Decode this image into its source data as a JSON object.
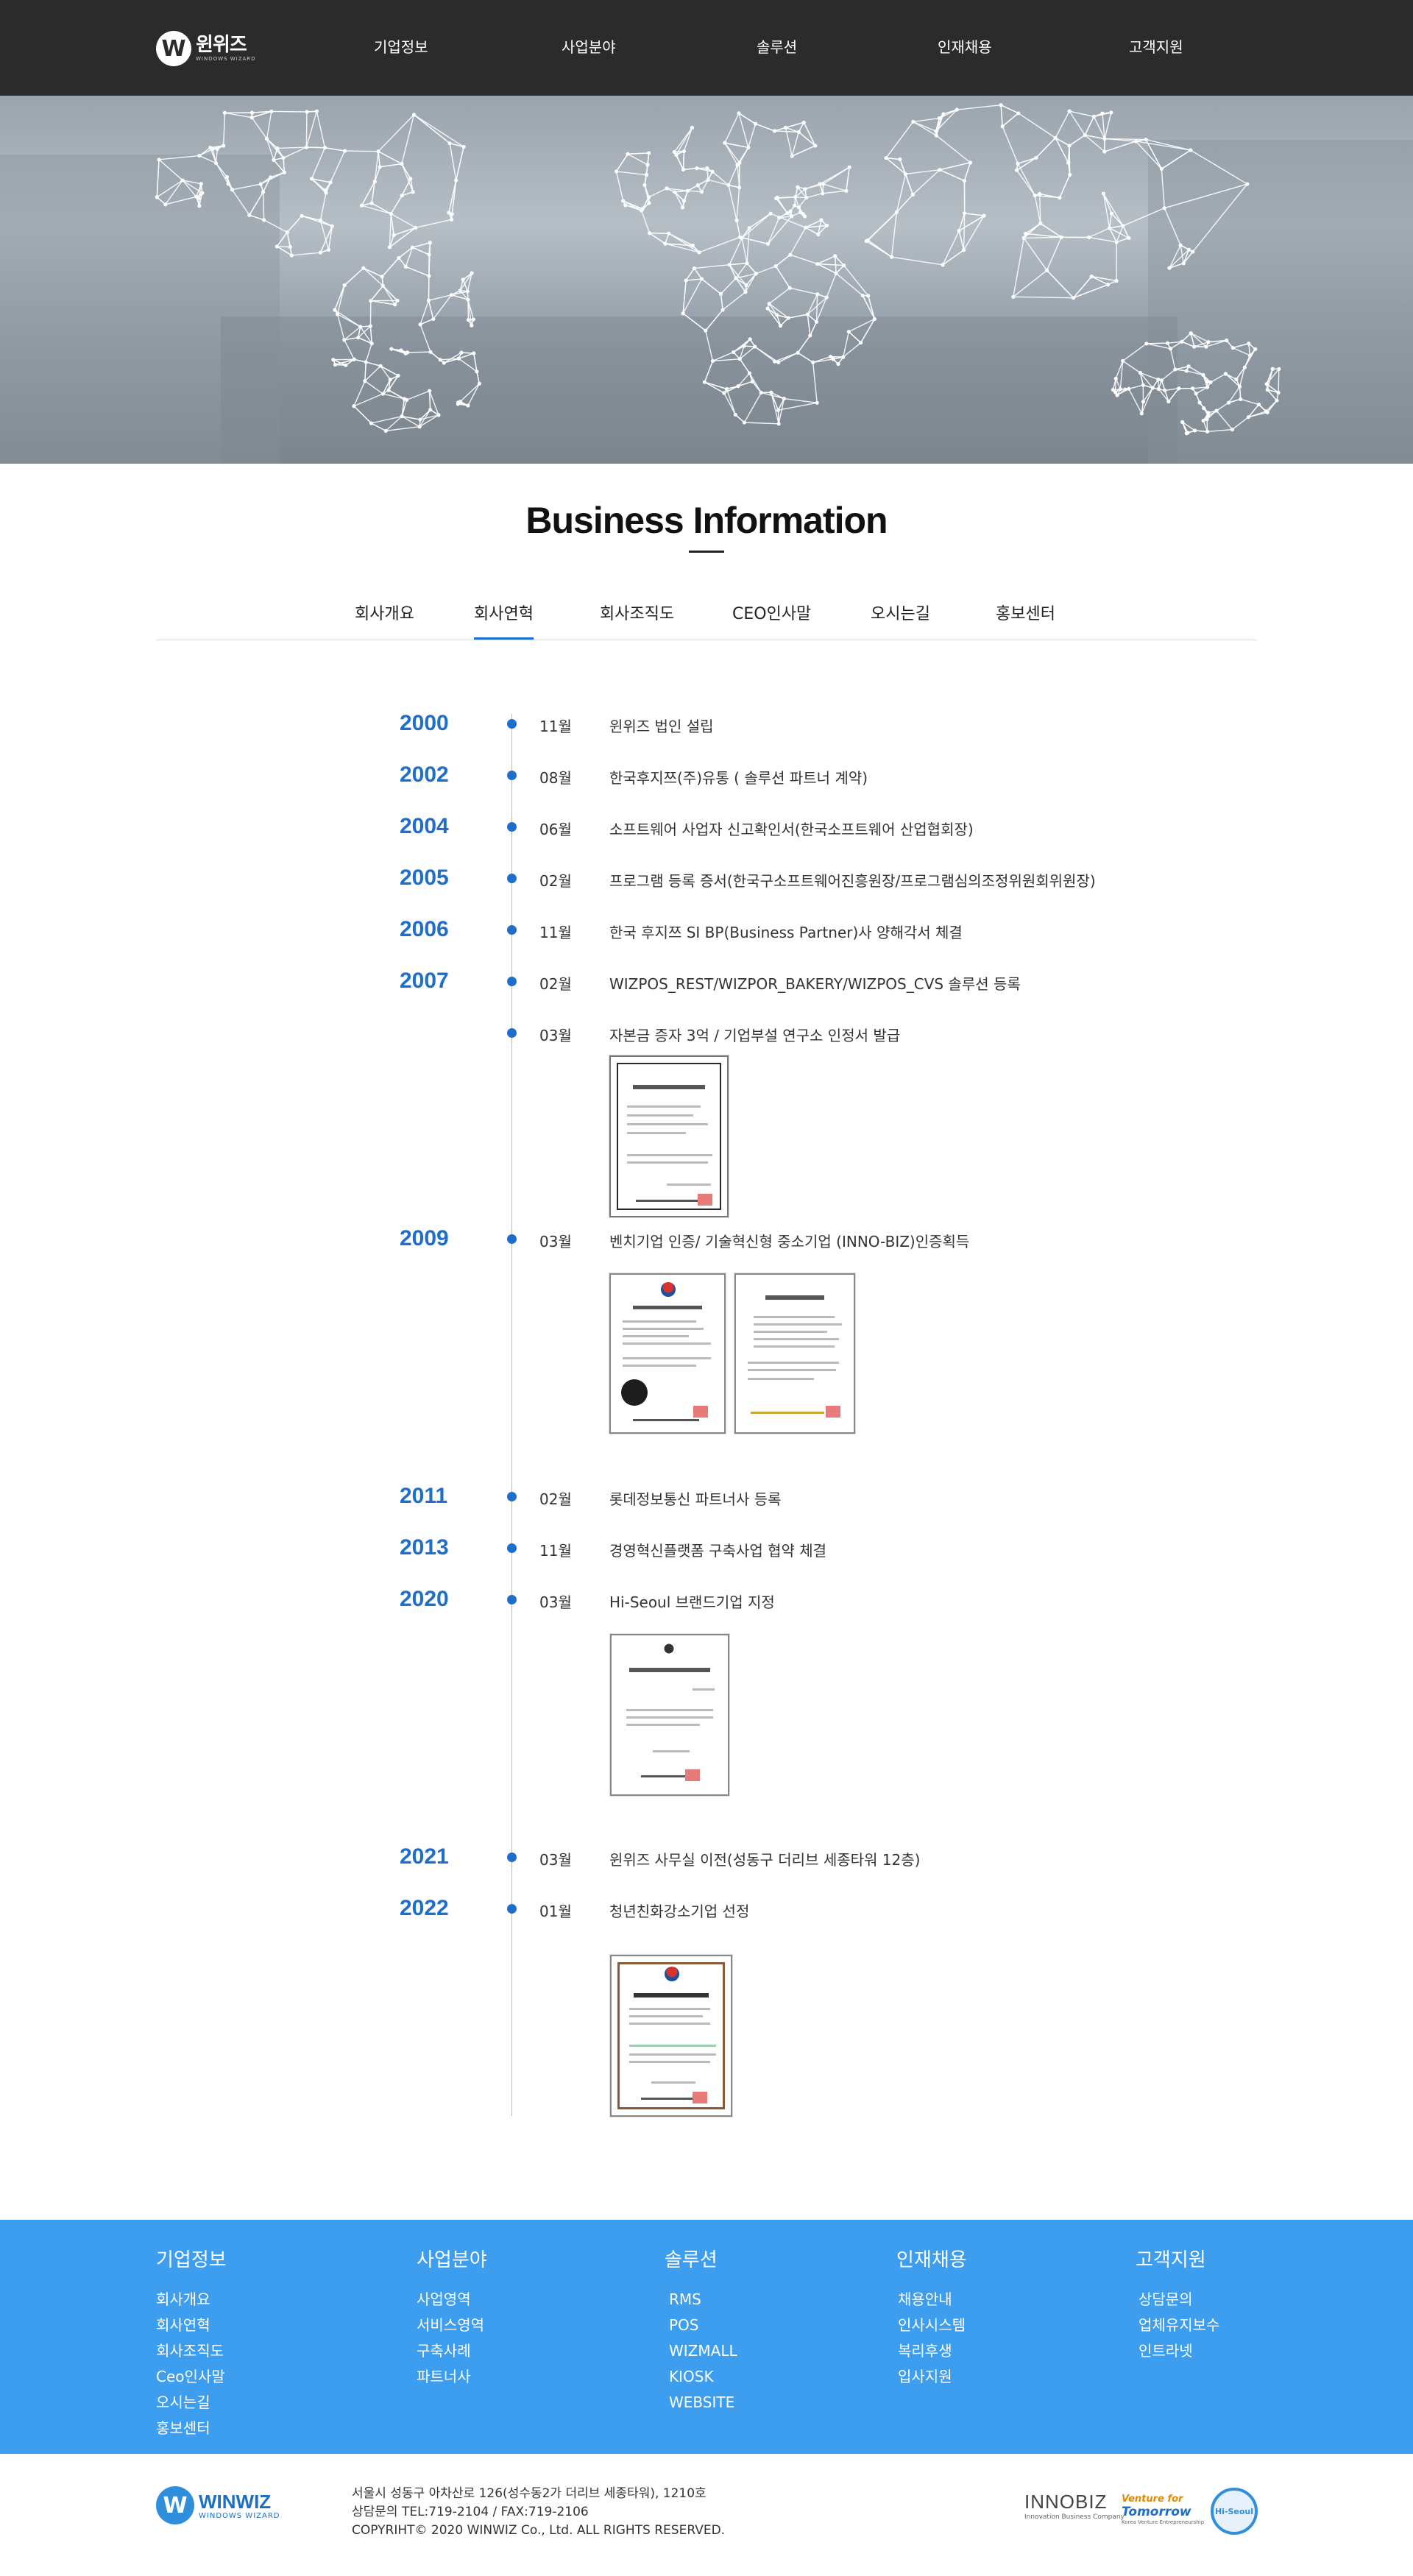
{
  "header": {
    "logo_letter": "W",
    "logo_text": "윈위즈",
    "logo_sub": "WINDOWS WIZARD",
    "nav": [
      "기업정보",
      "사업분야",
      "솔루션",
      "인재채용",
      "고객지원"
    ]
  },
  "main": {
    "title": "Business Information",
    "tabs": [
      "회사개요",
      "회사연혁",
      "회사조직도",
      "CEO인사말",
      "오시는길",
      "홍보센터"
    ],
    "active_tab": "회사연혁"
  },
  "history": [
    {
      "year": "2000",
      "month": "11월",
      "text": "윈위즈 법인 설립"
    },
    {
      "year": "2002",
      "month": "08월",
      "text": "한국후지쯔(주)유통 ( 솔루션 파트너 계약)"
    },
    {
      "year": "2004",
      "month": "06월",
      "text": "소프트웨어 사업자 신고확인서(한국소프트웨어 산업협회장)"
    },
    {
      "year": "2005",
      "month": "02월",
      "text": "프로그램 등록 증서(한국구소프트웨어진흥원장/프로그램심의조정위원회위원장)"
    },
    {
      "year": "2006",
      "month": "11월",
      "text": "한국 후지쯔 SI BP(Business Partner)사 양해각서 체결"
    },
    {
      "year": "2007",
      "month": "02월",
      "text": "WIZPOS_REST/WIZPOR_BAKERY/WIZPOS_CVS 솔루션 등록"
    },
    {
      "year": "",
      "month": "03월",
      "text": "자본금 증자 3억 / 기업부설 연구소 인정서 발급"
    },
    {
      "year": "2009",
      "month": "03월",
      "text": "벤치기업 인증/ 기술혁신형 중소기업 (INNO-BIZ)인증획득"
    },
    {
      "year": "2011",
      "month": "02월",
      "text": "롯데정보통신 파트너사 등록"
    },
    {
      "year": "2013",
      "month": "11월",
      "text": "경영혁신플랫폼 구축사업 협약 체결"
    },
    {
      "year": "2020",
      "month": "03월",
      "text": "Hi-Seoul 브랜드기업 지정"
    },
    {
      "year": "2021",
      "month": "03월",
      "text": "윈위즈 사무실 이전(성동구 더리브 세종타워 12층)"
    },
    {
      "year": "2022",
      "month": "01월",
      "text": "청년친화강소기업 선정"
    }
  ],
  "footer_nav": [
    {
      "title": "기업정보",
      "items": [
        "회사개요",
        "회사연혁",
        "회사조직도",
        "Ceo인사말",
        "오시는길",
        "홍보센터"
      ]
    },
    {
      "title": "사업분야",
      "items": [
        "사업영역",
        "서비스영역",
        "구축사례",
        "파트너사"
      ]
    },
    {
      "title": "솔루션",
      "items": [
        "RMS",
        "POS",
        "WIZMALL",
        "KIOSK",
        "WEBSITE"
      ]
    },
    {
      "title": "인재채용",
      "items": [
        "채용안내",
        "인사시스템",
        "복리후생",
        "입사지원"
      ]
    },
    {
      "title": "고객지원",
      "items": [
        "상담문의",
        "업체유지보수",
        "인트라넷"
      ]
    }
  ],
  "footer": {
    "logo_letter": "W",
    "logo_text": "WINWIZ",
    "logo_sub": "WINDOWS WIZARD",
    "address": "서울시 성동구 아차산로 126(성수동2가 더리브 세종타워), 1210호",
    "contact": "상담문의 TEL:719-2104 / FAX:719-2106",
    "copyright": "COPYRIHT© 2020 WINWIZ Co., Ltd. ALL RIGHTS RESERVED.",
    "badge1_main": "INNOBIZ",
    "badge1_sub": "Innovation Business Company",
    "badge2_top": "Venture for",
    "badge2_main": "Tomorrow",
    "badge2_sub": "Korea Venture Entrepreneurship",
    "badge3": "Hi-Seoul"
  },
  "colors": {
    "header_bg": "#2b2b2b",
    "accent_blue": "#1f6fc9",
    "footer_blue": "#3d9ef0"
  }
}
